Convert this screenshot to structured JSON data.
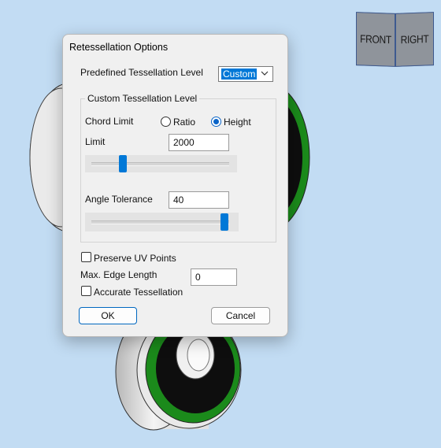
{
  "dialog": {
    "title": "Retessellation Options",
    "predefined_label": "Predefined Tessellation Level",
    "predefined_value": "Custom",
    "custom_group_title": "Custom Tessellation Level",
    "chord_limit_label": "Chord Limit",
    "ratio_label": "Ratio",
    "height_label": "Height",
    "selected_chord_mode": "Height",
    "limit_label": "Limit",
    "limit_value": "2000",
    "limit_slider_fraction": 0.2,
    "angle_label": "Angle Tolerance",
    "angle_value": "40",
    "angle_slider_fraction": 0.98,
    "preserve_uv_label": "Preserve UV Points",
    "preserve_uv_checked": false,
    "max_edge_label": "Max. Edge Length",
    "max_edge_value": "0",
    "accurate_label": "Accurate Tessellation",
    "accurate_checked": false,
    "ok_label": "OK",
    "cancel_label": "Cancel"
  },
  "viewcube": {
    "front_label": "FRONT",
    "right_label": "RIGHT"
  },
  "colors": {
    "background": "#c2dcf3",
    "accent": "#0078d7",
    "wheel_green": "#1b8a1b",
    "wheel_black": "#111111"
  },
  "icons": {
    "dropdown": "chevron-down-icon"
  }
}
